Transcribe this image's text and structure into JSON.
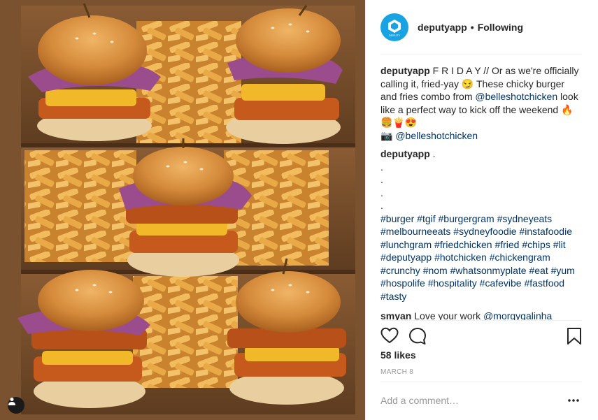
{
  "header": {
    "username": "deputyapp",
    "separator": "•",
    "follow_status": "Following",
    "avatar_label": "DEPUTY",
    "accent_color": "#1aa3e2"
  },
  "caption": {
    "username": "deputyapp",
    "text_1": "F R I D A Y // Or as we're officially calling it, fried-yay 😏 These chicky burger and fries combo from",
    "mention_1": "@belleshotchicken",
    "text_2": "look like a perfect way to kick off the weekend 🔥🍔🍟😍",
    "camera": "📷",
    "mention_2": "@belleshotchicken"
  },
  "hashtag_comment": {
    "username": "deputyapp",
    "first_line": ".",
    "dots": [
      ".",
      ".",
      ".",
      "."
    ],
    "hashtags": [
      "#burger",
      "#tgif",
      "#burgergram",
      "#sydneyeats",
      "#melbourneeats",
      "#sydneyfoodie",
      "#instafoodie",
      "#lunchgram",
      "#friedchicken",
      "#fried",
      "#chips",
      "#lit",
      "#deputyapp",
      "#hotchicken",
      "#chickengram",
      "#crunchy",
      "#nom",
      "#whatsonmyplate",
      "#eat",
      "#yum",
      "#hospolife",
      "#hospitality",
      "#cafevibe",
      "#fastfood",
      "#tasty"
    ]
  },
  "comment": {
    "username": "smyan",
    "text": "Love your work",
    "mention": "@morgygalinha"
  },
  "actions": {
    "like_icon": "heart-icon",
    "comment_icon": "comment-bubble-icon",
    "save_icon": "bookmark-icon"
  },
  "likes": "58 likes",
  "date": "MARCH 8",
  "add_comment": {
    "placeholder": "Add a comment…"
  },
  "more_icon": "ellipsis-icon",
  "photo": {
    "tag_icon": "user-tag-icon"
  }
}
